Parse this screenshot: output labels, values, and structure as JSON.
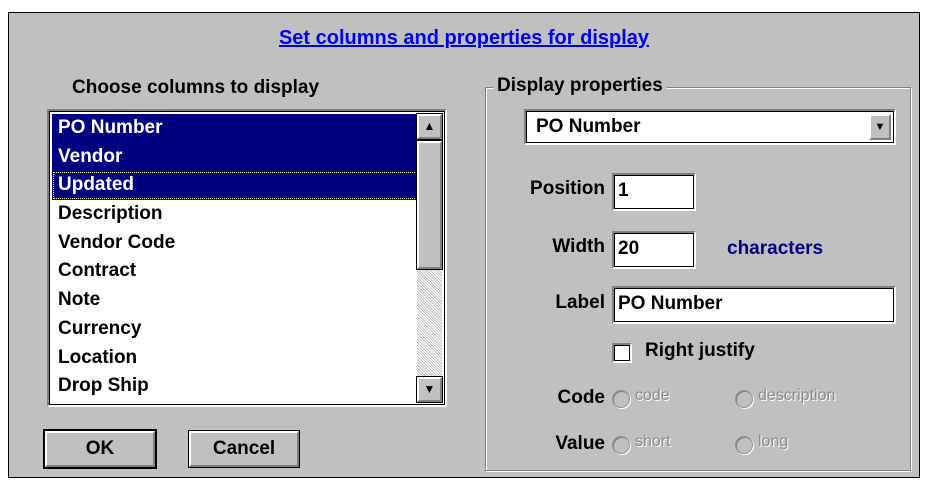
{
  "dialog": {
    "title": "Set columns and properties for display",
    "list_caption": "Choose columns to display",
    "columns": [
      {
        "label": "PO Number",
        "selected": true
      },
      {
        "label": "Vendor",
        "selected": true
      },
      {
        "label": "Updated",
        "selected": true
      },
      {
        "label": "Description",
        "selected": false
      },
      {
        "label": "Vendor Code",
        "selected": false
      },
      {
        "label": "Contract",
        "selected": false
      },
      {
        "label": "Note",
        "selected": false
      },
      {
        "label": "Currency",
        "selected": false
      },
      {
        "label": "Location",
        "selected": false
      },
      {
        "label": "Drop Ship",
        "selected": false
      }
    ],
    "ok_label": "OK",
    "cancel_label": "Cancel"
  },
  "properties": {
    "group_label": "Display properties",
    "column_select": "PO Number",
    "position_label": "Position",
    "position_value": "1",
    "width_label": "Width",
    "width_value": "20",
    "width_unit": "characters",
    "label_label": "Label",
    "label_value": "PO Number",
    "right_justify_label": "Right justify",
    "right_justify_checked": false,
    "code_label": "Code",
    "code_options": [
      "code",
      "description"
    ],
    "value_label": "Value",
    "value_options": [
      "short",
      "long"
    ]
  },
  "icons": {
    "scroll_up": "▲",
    "scroll_down": "▼",
    "dropdown": "▼"
  },
  "colors": {
    "face": "#c0c0c0",
    "selection": "#000080",
    "link": "#0000ee",
    "accent_text": "#000080",
    "disabled_text": "#8a8a8a"
  }
}
